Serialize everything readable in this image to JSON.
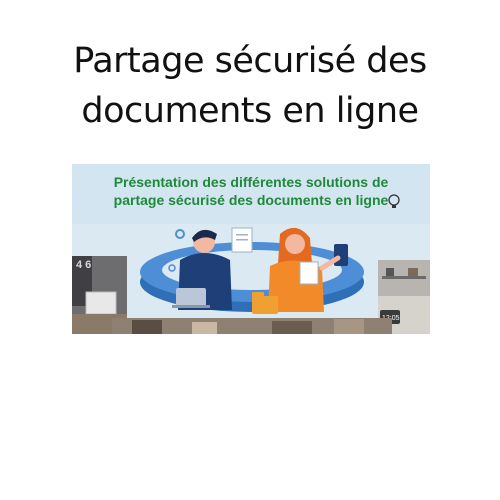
{
  "title": {
    "line1": "Partage sécurisé des",
    "line2": "documents en ligne"
  },
  "banner": {
    "heading_line1": "Présentation des différentes solutions de",
    "heading_line2": "partage sécurisé des documents en ligne",
    "heading_color": "#1e8a3a",
    "background_color": "#cfe3ef",
    "icons": [
      "lightbulb-icon",
      "gear-icon",
      "document-icon",
      "folder-icon",
      "laptop-icon",
      "smartphone-icon",
      "clock-icon"
    ],
    "clock_display": "12:05",
    "wall_digits": "4 6"
  }
}
